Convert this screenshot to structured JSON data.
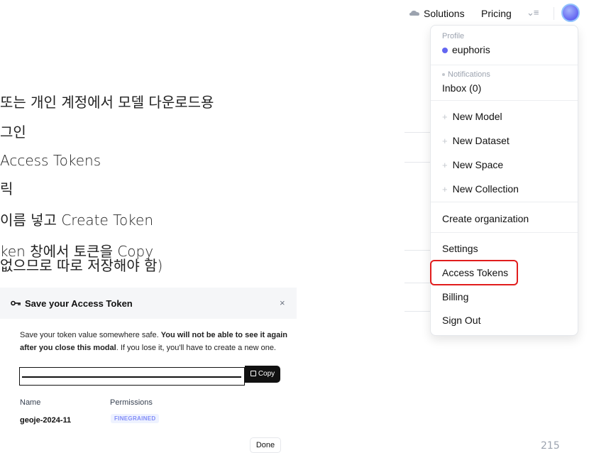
{
  "slide": {
    "lines": [
      "또는 개인 계정에서 모델 다운로드용",
      "그인",
      "Access Tokens",
      "릭",
      "이름 넣고 Create Token",
      "ken 창에서 토큰을 Copy",
      "없으므로 따로 저장해야 함)"
    ],
    "page_number": "215"
  },
  "nav": {
    "solutions": "Solutions",
    "pricing": "Pricing",
    "more": "⌄≡",
    "cloud_icon": "cloud-icon",
    "avatar_icon": "avatar"
  },
  "dropdown": {
    "profile_label": "Profile",
    "username": "euphoris",
    "notifications_label": "Notifications",
    "inbox": "Inbox (0)",
    "new_items": [
      "New Model",
      "New Dataset",
      "New Space",
      "New Collection"
    ],
    "create_org": "Create organization",
    "settings": "Settings",
    "access_tokens": "Access Tokens",
    "billing": "Billing",
    "sign_out": "Sign Out",
    "highlight_color": "#e11d1d"
  },
  "modal": {
    "title": "Save your Access Token",
    "close": "×",
    "desc_part1": "Save your token value somewhere safe. ",
    "desc_bold": "You will not be able to see it again after you close this modal",
    "desc_part2": ". If you lose it, you'll have to create a new one.",
    "copy_label": "Copy",
    "col_name": "Name",
    "col_permissions": "Permissions",
    "token_name": "geoje-2024-11",
    "permission_badge": "FINEGRAINED",
    "done_label": "Done"
  }
}
